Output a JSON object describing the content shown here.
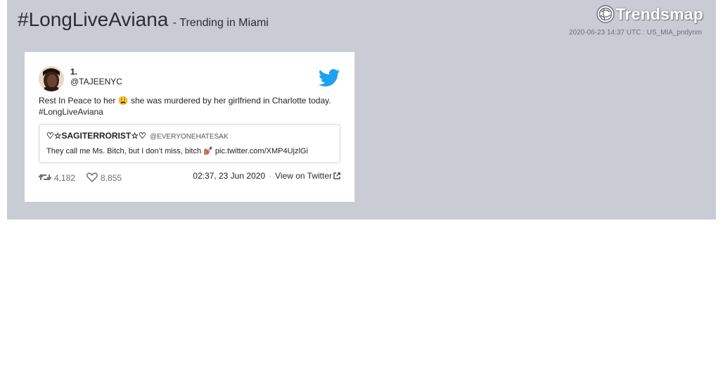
{
  "header": {
    "hashtag": "#LongLiveAviana",
    "subtitle": "- Trending in Miami",
    "brand_name": "Trendsmap",
    "meta": "2020-06-23 14:37 UTC : US_MIA_pndynm"
  },
  "tweet": {
    "rank": "1.",
    "handle": "@TAJEENYC",
    "text_line1": "Rest In Peace to her 😩 she was murdered by her girlfriend in Charlotte today.",
    "text_line2": "#LongLiveAviana",
    "quote": {
      "name": "♡☆SAGITERRORIST☆♡",
      "handle": "@EVERYONEHATESAK",
      "text": "They call me Ms. Bitch, but I don’t miss, bitch 💅🏽 ",
      "link": "pic.twitter.com/XMP4UjzlGi"
    },
    "retweets": "4,182",
    "likes": "8,855",
    "timestamp": "02:37, 23 Jun 2020",
    "separator": "·",
    "view_label": "View on Twitter"
  },
  "icons": {
    "brand": "globe-icon",
    "platform": "twitter-bird-icon",
    "retweet": "retweet-icon",
    "like": "heart-icon",
    "external": "external-link-icon"
  },
  "colors": {
    "panel_bg": "#c9ccd5",
    "twitter_blue": "#1da1f2",
    "card_bg": "#ffffff"
  }
}
